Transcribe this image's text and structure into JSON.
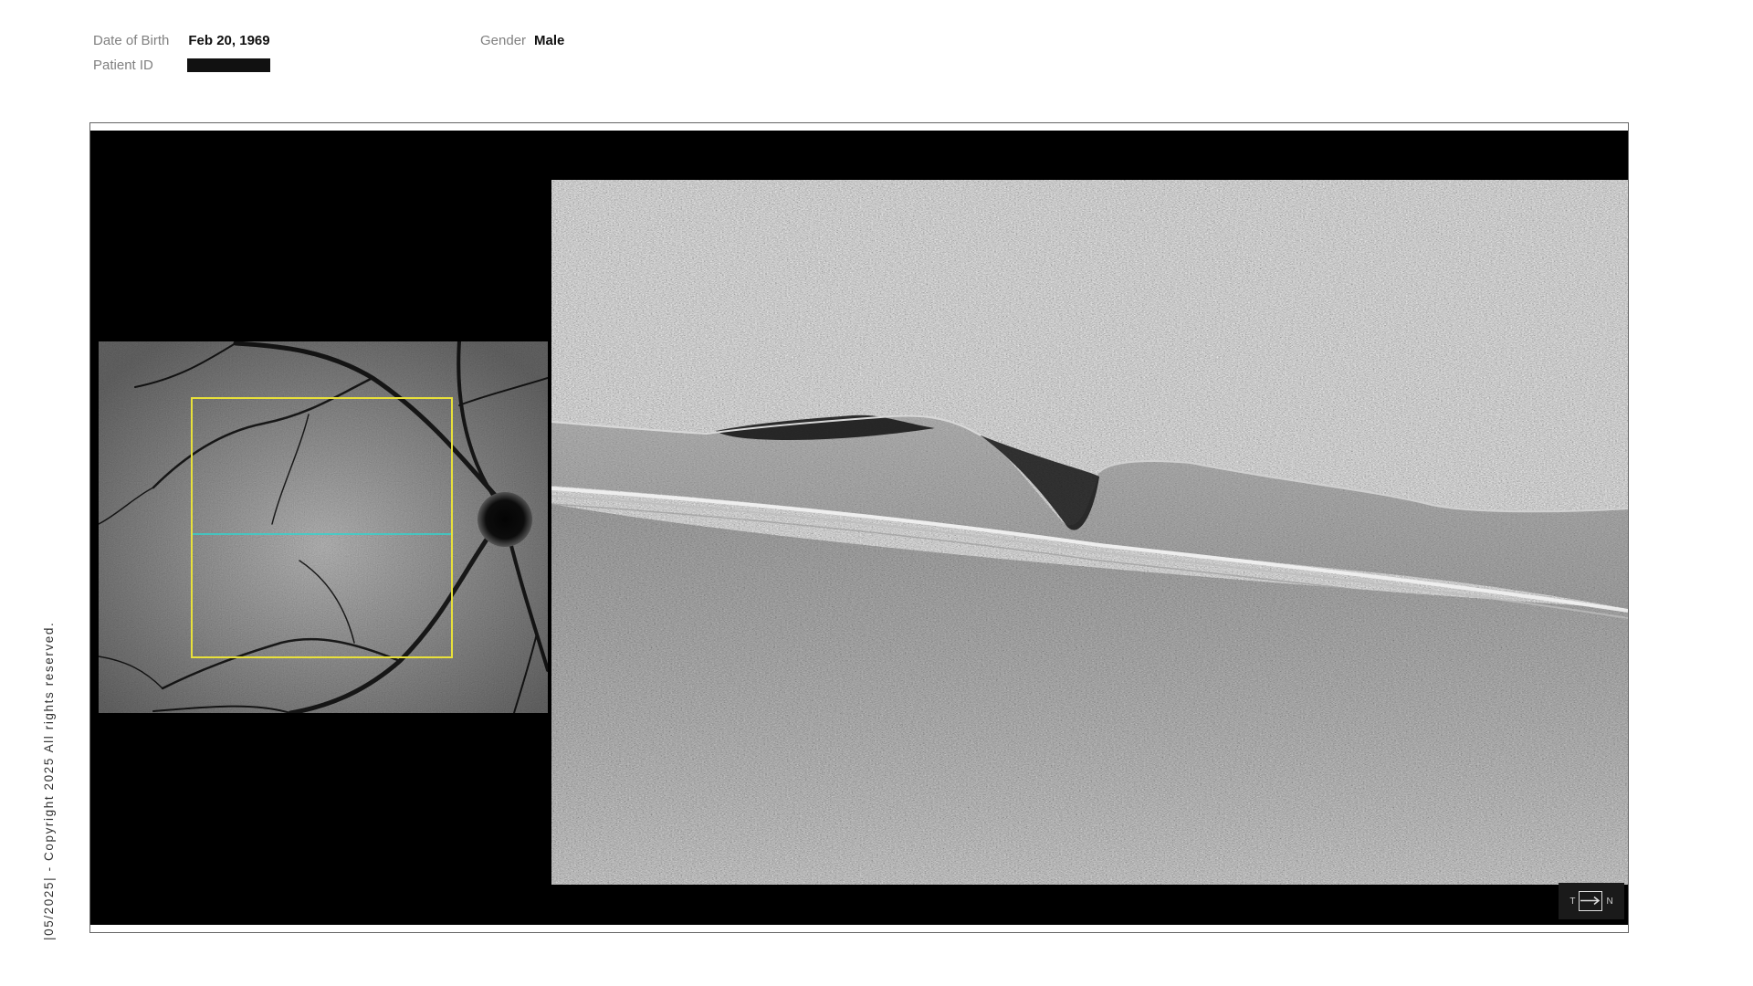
{
  "patient": {
    "dob_label": "Date of Birth",
    "dob_value": "Feb 20, 1969",
    "gender_label": "Gender",
    "gender_value": "Male",
    "patient_id_label": "Patient ID"
  },
  "scan": {
    "orientation_left": "T",
    "orientation_right": "N",
    "scan_box_color": "#e8e03a",
    "scan_line_color": "#2fd6d0"
  },
  "footer": {
    "copyright": "|05/2025| - Copyright 2025 All rights reserved."
  }
}
